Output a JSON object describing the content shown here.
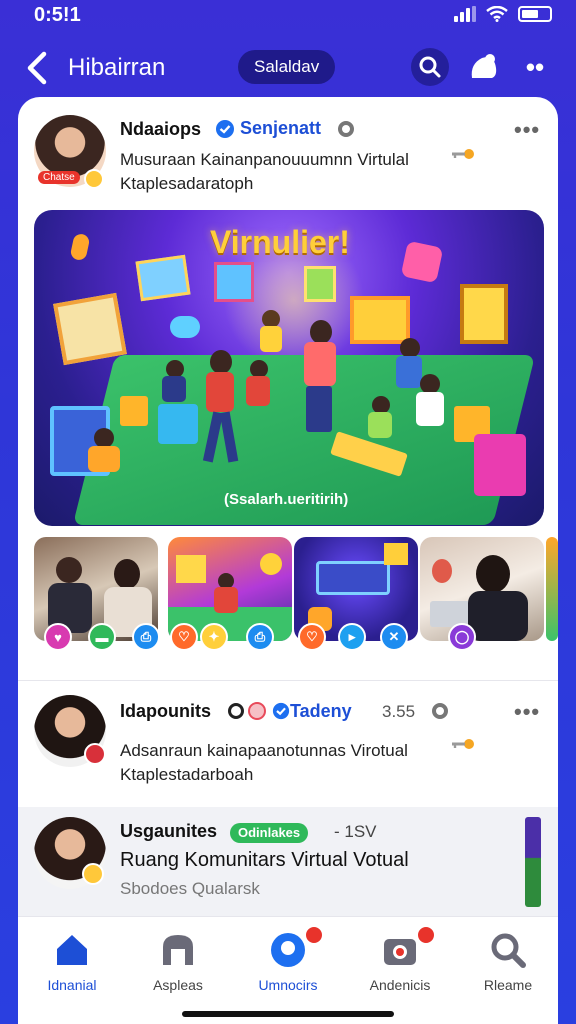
{
  "status_bar": {
    "time": "0:5!1"
  },
  "header": {
    "title": "Hibairran",
    "chip": "Salaldav"
  },
  "posts": [
    {
      "name": "Ndaaiops",
      "tag": "Senjenatt",
      "line1": "Musuraan Kainanpanouuumnn Virtulal",
      "line2": "Ktaplesadaratoph",
      "badge": "Chatse"
    },
    {
      "name": "Idapounits",
      "tag": "Tadeny",
      "meta": "3.55",
      "line1": "Adsanraun kainapaanotunnas Virotual",
      "line2": "Ktaplestadarboah"
    },
    {
      "name": "Usgaunites",
      "status": "Odinlakes",
      "meta": "- 1SV",
      "line1": "Ruang Komunitars Virtual Votual",
      "line2": "Sbodoes Qualarsk"
    }
  ],
  "hero": {
    "title": "Virnulier!",
    "caption": "(Ssalarh.ueritirih)"
  },
  "bottom_nav": [
    {
      "label": "Idnanial"
    },
    {
      "label": "Aspleas"
    },
    {
      "label": "Umnocirs"
    },
    {
      "label": "Andenicis"
    },
    {
      "label": "Rleame"
    }
  ],
  "colors": {
    "brand": "#3a2fd6",
    "active": "#1d4fd6",
    "badge": "#e8332b",
    "status_green": "#2fb95a"
  },
  "icons": [
    "back-icon",
    "search-icon",
    "bell-icon",
    "more-icon",
    "home-icon",
    "explore-icon",
    "chat-icon",
    "media-icon",
    "search-nav-icon"
  ]
}
